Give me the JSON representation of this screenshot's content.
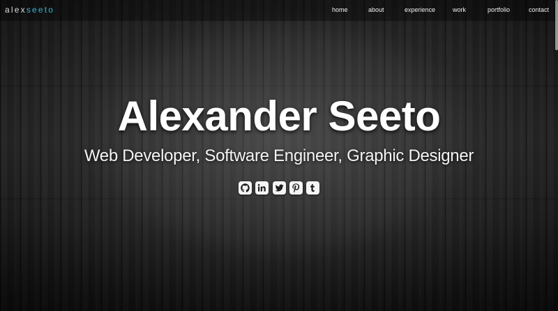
{
  "brand": {
    "logo_part1": "alex",
    "logo_part2": "seeto",
    "accent_color": "#35b6d9"
  },
  "nav": {
    "items": [
      {
        "label": "home"
      },
      {
        "label": "about"
      },
      {
        "label": "experience"
      },
      {
        "label": "work"
      },
      {
        "label": "portfolio"
      },
      {
        "label": "contact"
      }
    ]
  },
  "hero": {
    "name": "Alexander Seeto",
    "subtitle": "Web Developer, Software Engineer, Graphic Designer"
  },
  "social": [
    {
      "icon": "github-icon"
    },
    {
      "icon": "linkedin-icon"
    },
    {
      "icon": "twitter-icon"
    },
    {
      "icon": "pinterest-icon"
    },
    {
      "icon": "tumblr-icon"
    }
  ]
}
